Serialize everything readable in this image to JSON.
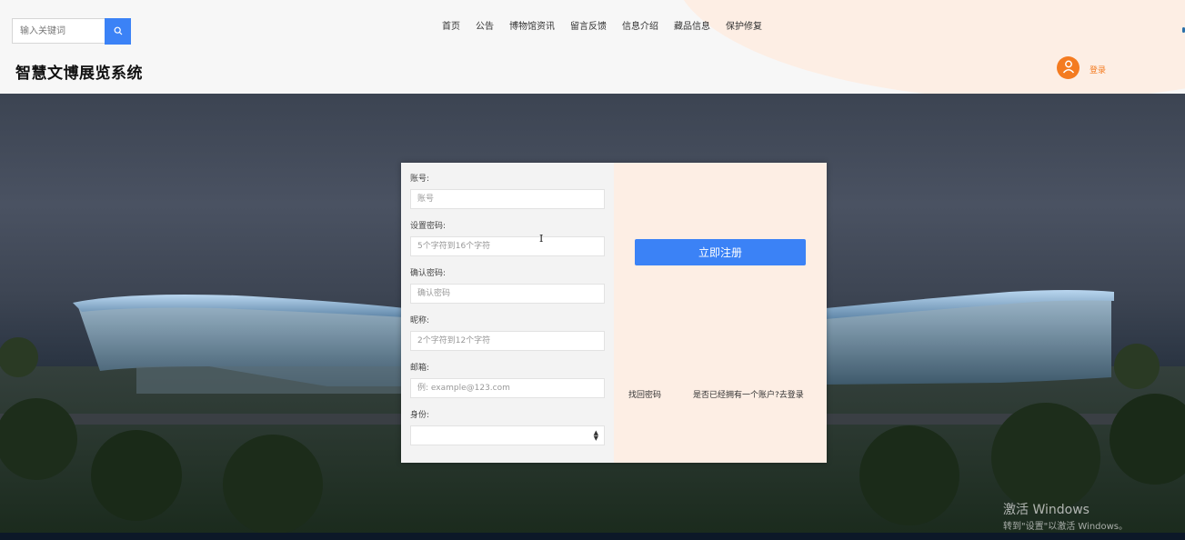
{
  "header": {
    "search": {
      "placeholder": "输入关键词",
      "icon": "search-icon"
    },
    "nav": [
      {
        "label": "首页"
      },
      {
        "label": "公告"
      },
      {
        "label": "博物馆资讯"
      },
      {
        "label": "留言反馈"
      },
      {
        "label": "信息介绍"
      },
      {
        "label": "藏品信息"
      },
      {
        "label": "保护修复"
      }
    ],
    "site_title": "智慧文博展览系统",
    "user": {
      "icon": "user-avatar-icon",
      "login_label": "登录"
    }
  },
  "form": {
    "fields": [
      {
        "label": "账号:",
        "placeholder": "账号",
        "value": ""
      },
      {
        "label": "设置密码:",
        "placeholder": "5个字符到16个字符",
        "value": ""
      },
      {
        "label": "确认密码:",
        "placeholder": "确认密码",
        "value": ""
      },
      {
        "label": "昵称:",
        "placeholder": "2个字符到12个字符",
        "value": ""
      },
      {
        "label": "邮箱:",
        "placeholder": "例: example@123.com",
        "value": ""
      }
    ],
    "identity": {
      "label": "身份:",
      "selected": ""
    },
    "register_label": "立即注册",
    "forgot_label": "找回密码",
    "have_account_label": "是否已经拥有一个账户?去登录"
  },
  "watermark": {
    "title": "激活 Windows",
    "subtitle": "转到\"设置\"以激活 Windows。"
  },
  "colors": {
    "accent": "#3b82f6",
    "brand_orange": "#f47b20",
    "panel_peach": "#fdeee4",
    "header_bg": "#f7f7f7"
  }
}
